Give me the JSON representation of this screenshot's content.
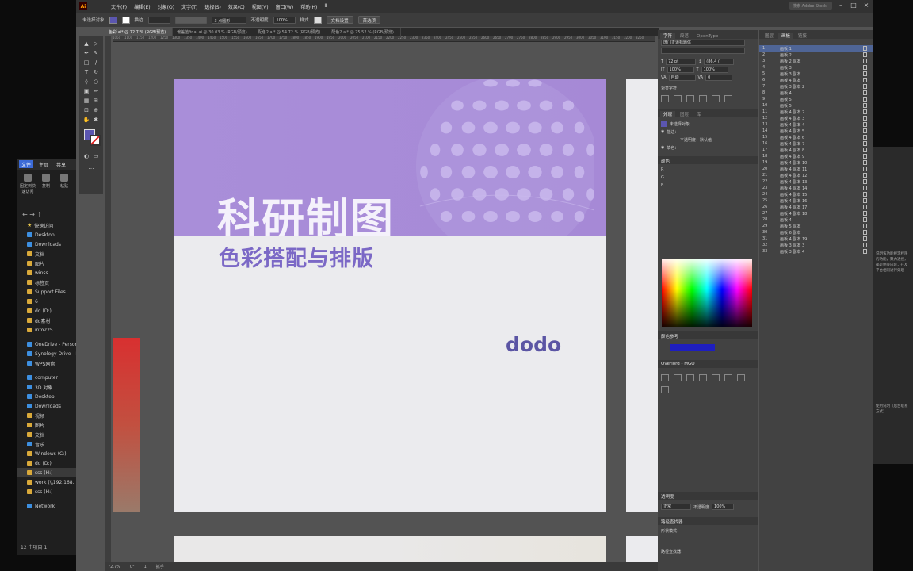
{
  "explorer": {
    "ribbon_tabs": [
      "文件",
      "主页",
      "共享"
    ],
    "tools": [
      {
        "label": "固定到快速访问",
        "icon": "pin-icon"
      },
      {
        "label": "复制",
        "icon": "copy-icon"
      },
      {
        "label": "粘贴",
        "icon": "paste-icon"
      }
    ],
    "nav_arrows": "← → ↑",
    "tree": [
      {
        "label": "快速访问",
        "icon": "star"
      },
      {
        "label": "Desktop",
        "icon": "blue"
      },
      {
        "label": "Downloads",
        "icon": "blue"
      },
      {
        "label": "文档",
        "icon": "folder"
      },
      {
        "label": "图片",
        "icon": "folder"
      },
      {
        "label": "winss",
        "icon": "folder"
      },
      {
        "label": "标签页",
        "icon": "folder"
      },
      {
        "label": "Support Files",
        "icon": "folder"
      },
      {
        "label": "6",
        "icon": "folder"
      },
      {
        "label": "dd (D:)",
        "icon": "folder"
      },
      {
        "label": "do素材",
        "icon": "folder"
      },
      {
        "label": "info225",
        "icon": "folder"
      },
      {
        "label": "OneDrive - Person",
        "icon": "blue"
      },
      {
        "label": "Synology Drive - I",
        "icon": "blue"
      },
      {
        "label": "WPS网盘",
        "icon": "blue"
      },
      {
        "label": "computer",
        "icon": "blue"
      },
      {
        "label": "3D 对象",
        "icon": "blue"
      },
      {
        "label": "Desktop",
        "icon": "blue"
      },
      {
        "label": "Downloads",
        "icon": "blue"
      },
      {
        "label": "视频",
        "icon": "folder"
      },
      {
        "label": "图片",
        "icon": "folder"
      },
      {
        "label": "文档",
        "icon": "folder"
      },
      {
        "label": "音乐",
        "icon": "blue"
      },
      {
        "label": "Windows (C:)",
        "icon": "folder"
      },
      {
        "label": "dd (D:)",
        "icon": "folder"
      },
      {
        "label": "sss (H:)",
        "icon": "folder"
      },
      {
        "label": "work (\\\\192.168.",
        "icon": "folder"
      },
      {
        "label": "sss (H:)",
        "icon": "folder"
      },
      {
        "label": "Network",
        "icon": "blue"
      }
    ],
    "status": "12 个项目  1"
  },
  "app": {
    "logo": "Ai",
    "menus": [
      "文件(F)",
      "编辑(E)",
      "对象(O)",
      "文字(T)",
      "选择(S)",
      "效果(C)",
      "视图(V)",
      "窗口(W)",
      "帮助(H)",
      "Ⅲ"
    ],
    "search_placeholder": "搜索 Adobe Stock",
    "control_bar": {
      "selection": "未选择对象",
      "stroke_label": "描边",
      "points": "3 点圆形",
      "opacity_label": "不透明度",
      "opacity": "100%",
      "style_label": "样式",
      "doc_setup": "文档设置",
      "prefs": "首选项"
    },
    "tabs": [
      "色彩.ai* @ 72.7 % (RGB/预览)",
      "偏差值final.ai @ 30.03 % (RGB/预览)",
      "配色2.ai* @ 54.72 % (RGB/预览)",
      "配色2.ai* @ 75.52 % (RGB/预览)"
    ],
    "ruler_ticks": [
      "1050",
      "1100",
      "1150",
      "1200",
      "1250",
      "1300",
      "1350",
      "1400",
      "1450",
      "1500",
      "1550",
      "1600",
      "1650",
      "1700",
      "1750",
      "1800",
      "1850",
      "1900",
      "1950",
      "2000",
      "2050",
      "2100",
      "2150",
      "2200",
      "2250",
      "2300",
      "2350",
      "2400",
      "2450",
      "2500",
      "2550",
      "2600",
      "2650",
      "2700",
      "2750",
      "2800",
      "2850",
      "2900",
      "2950",
      "3000",
      "3050",
      "3100",
      "3150",
      "3200",
      "3250"
    ],
    "status": {
      "zoom": "72.7%",
      "angle": "0°",
      "page": "1",
      "tool": "抓手"
    }
  },
  "artwork": {
    "title": "科研制图",
    "subtitle": "色彩搭配与排版",
    "brand": "dodo"
  },
  "char_panel": {
    "tabs": [
      "字符",
      "段落",
      "OpenType"
    ],
    "font": "庞门正道标题体",
    "size": "72 pt",
    "leading": "(86.4 (",
    "scale_h": "100%",
    "scale_v": "100%",
    "tracking": "自动",
    "kerning": "0",
    "align_head": "对齐字符"
  },
  "appearance_panel": {
    "tabs": [
      "外观",
      "图层",
      "库"
    ],
    "rows": [
      "未选择对象",
      "描边：",
      "不透明度：默认值",
      "填色："
    ]
  },
  "color_panel": {
    "title": "颜色",
    "labels": [
      "R",
      "G",
      "B"
    ]
  },
  "color_guide": {
    "title": "颜色参考"
  },
  "overlord": {
    "title": "Overlord - MGO"
  },
  "transparency": {
    "title": "透明度",
    "mode": "正常",
    "opacity_label": "不透明度",
    "opacity": "100%"
  },
  "pathfinder": {
    "title": "路径查找器",
    "shape_modes": "形状模式：",
    "pathfinders": "路径查找器："
  },
  "artboards_panel": {
    "tabs": [
      "图层",
      "画板",
      "链接"
    ],
    "rows": [
      {
        "n": "1",
        "name": "画板 1"
      },
      {
        "n": "2",
        "name": "画板 2"
      },
      {
        "n": "3",
        "name": "画板 2 副本"
      },
      {
        "n": "4",
        "name": "画板 3"
      },
      {
        "n": "5",
        "name": "画板 3 副本"
      },
      {
        "n": "6",
        "name": "画板 4 副本"
      },
      {
        "n": "7",
        "name": "画板 3 副本 2"
      },
      {
        "n": "8",
        "name": "画板 4"
      },
      {
        "n": "9",
        "name": "画板 5"
      },
      {
        "n": "10",
        "name": "画板 5"
      },
      {
        "n": "11",
        "name": "画板 4 副本 2"
      },
      {
        "n": "12",
        "name": "画板 4 副本 3"
      },
      {
        "n": "13",
        "name": "画板 4 副本 4"
      },
      {
        "n": "14",
        "name": "画板 4 副本 5"
      },
      {
        "n": "15",
        "name": "画板 4 副本 6"
      },
      {
        "n": "16",
        "name": "画板 4 副本 7"
      },
      {
        "n": "17",
        "name": "画板 4 副本 8"
      },
      {
        "n": "18",
        "name": "画板 4 副本 9"
      },
      {
        "n": "19",
        "name": "画板 4 副本 10"
      },
      {
        "n": "20",
        "name": "画板 4 副本 11"
      },
      {
        "n": "21",
        "name": "画板 4 副本 12"
      },
      {
        "n": "22",
        "name": "画板 4 副本 13"
      },
      {
        "n": "23",
        "name": "画板 4 副本 14"
      },
      {
        "n": "24",
        "name": "画板 4 副本 15"
      },
      {
        "n": "25",
        "name": "画板 4 副本 16"
      },
      {
        "n": "26",
        "name": "画板 4 副本 17"
      },
      {
        "n": "27",
        "name": "画板 4 副本 18"
      },
      {
        "n": "28",
        "name": "画板 4"
      },
      {
        "n": "29",
        "name": "画板 5 副本"
      },
      {
        "n": "30",
        "name": "画板 6 副本"
      },
      {
        "n": "31",
        "name": "画板 4 副本 19"
      },
      {
        "n": "32",
        "name": "画板 3 副本 3"
      },
      {
        "n": "33",
        "name": "画板 3 副本 4"
      }
    ]
  },
  "right_app": {
    "text": "说明该功能规定权限的功能，聚力透视，都是相关内容，在及平台相同进行处理",
    "footer": "使用说明（后台联系方式）"
  },
  "colors": {
    "banner": "#a78bd8",
    "title_sub": "#7b68c6",
    "brand": "#5b55a4",
    "fill_swatch": "#5b56b0",
    "selection": "#4f6596"
  }
}
